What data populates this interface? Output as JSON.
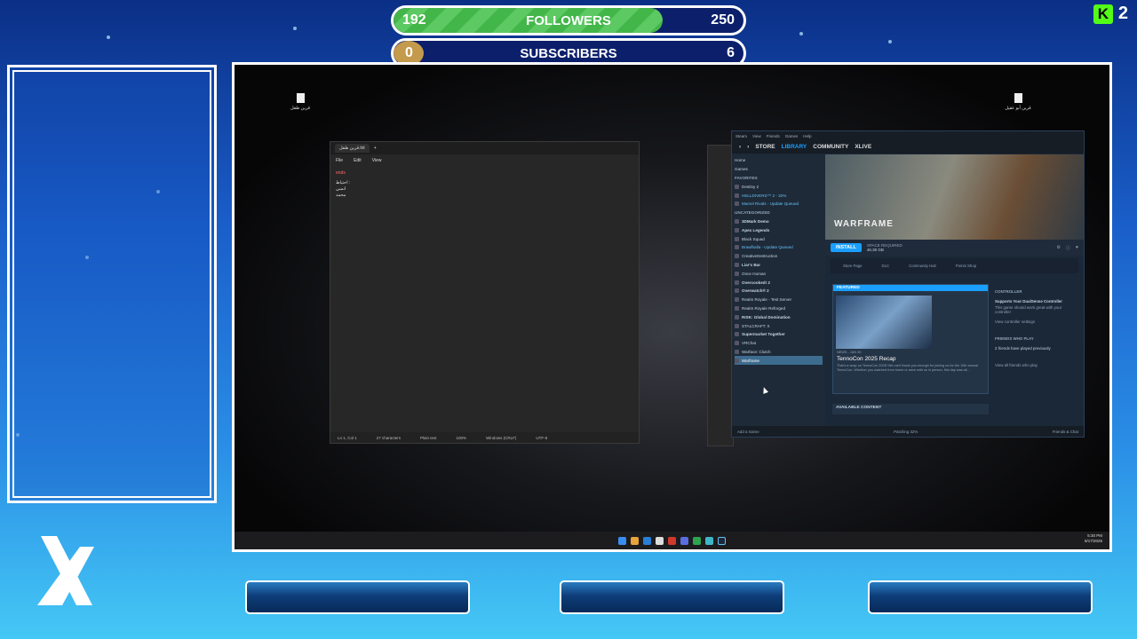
{
  "overlay": {
    "followers": {
      "current": "192",
      "goal": "250",
      "label": "FOLLOWERS",
      "progress": 0.768
    },
    "subscribers": {
      "current": "0",
      "goal": "6",
      "label": "SUBSCRIBERS",
      "progress": 0
    },
    "brand": {
      "icon": "kick-logo-icon",
      "letter": "K",
      "count": "2"
    },
    "colors": {
      "followers_fill": "#43b649",
      "subscribers_fill": "#c49a4d",
      "bar_bg": "#0c1f6b",
      "kick_green": "#53fc18"
    }
  },
  "desktop": {
    "icons": [
      {
        "label": "قرين طفل"
      },
      {
        "label": "قرين أبو عقيل"
      }
    ],
    "notepad": {
      "tab": "قرين طفل.txt",
      "menu": [
        "File",
        "Edit",
        "View"
      ],
      "lines": [
        "ends",
        "احتياط :",
        "انسي",
        "محمد"
      ],
      "status": [
        "Ln 1, Col 1",
        "27 characters",
        "Plain text",
        "100%",
        "Windows (CRLF)",
        "UTF-8"
      ]
    },
    "steam": {
      "title_menu": [
        "Steam",
        "View",
        "Friends",
        "Games",
        "Help"
      ],
      "nav": [
        "STORE",
        "LIBRARY",
        "COMMUNITY",
        "XLIVE"
      ],
      "active_nav": "LIBRARY",
      "home": "Home",
      "filter": "Games",
      "favorites_header": "FAVORITES",
      "favorites": [
        {
          "name": "Destiny 2",
          "style": "normal"
        },
        {
          "name": "HELLDIVERS™ 2 - 32%",
          "style": "blue"
        },
        {
          "name": "Marvel Rivals - Update Queued",
          "style": "blue"
        }
      ],
      "uncategorized_header": "UNCATEGORIZED",
      "games": [
        {
          "name": "3DMark Demo",
          "style": "bold"
        },
        {
          "name": "Apex Legends",
          "style": "bold"
        },
        {
          "name": "Black Squad",
          "style": "normal"
        },
        {
          "name": "Brawlhalla - Update Queued",
          "style": "blue"
        },
        {
          "name": "CreativeDestruction",
          "style": "normal"
        },
        {
          "name": "Liar's Bar",
          "style": "bold"
        },
        {
          "name": "Once Human",
          "style": "normal"
        },
        {
          "name": "Overcooked! 2",
          "style": "bold"
        },
        {
          "name": "Overwatch® 2",
          "style": "bold"
        },
        {
          "name": "Realm Royale - Test Server",
          "style": "normal"
        },
        {
          "name": "Realm Royale Reforged",
          "style": "normal"
        },
        {
          "name": "RISK: Global Domination",
          "style": "bold"
        },
        {
          "name": "STALCRAFT: X",
          "style": "normal"
        },
        {
          "name": "Supermarket Together",
          "style": "bold"
        },
        {
          "name": "VRChat",
          "style": "normal"
        },
        {
          "name": "Warface: Clutch",
          "style": "normal"
        },
        {
          "name": "Warframe",
          "style": "selected"
        }
      ],
      "game_title": "WARFRAME",
      "install": "INSTALL",
      "space_label": "SPACE REQUIRED",
      "space_value": "46.30 GB",
      "links": [
        "Store Page",
        "DLC",
        "Community Hub",
        "Points Shop"
      ],
      "featured_header": "FEATURED",
      "featured_date": "NEWS - JUN 30",
      "featured_title": "TennoCon 2025 Recap",
      "featured_text": "That's a wrap on TennoCon 2025! We can't thank you enough for joining us for the 10th annual TennoCon. Whether you watched from home or were with us in person, this day was all...",
      "controller_header": "CONTROLLER",
      "controller_title": "Supports Your DualSense Controller",
      "controller_text": "This game should work great with your controller",
      "controller_link": "View controller settings",
      "friends_header": "FRIENDS WHO PLAY",
      "friends_text": "2 friends have played previously",
      "friends_link": "View all friends who play",
      "available": "AVAILABLE CONTENT",
      "add_game": "Add a Game",
      "download": "Patching",
      "download_pct": "32%",
      "friends_chat": "Friends & Chat"
    },
    "taskbar": {
      "time": "5:30 PM",
      "date": "8/17/2025"
    }
  }
}
